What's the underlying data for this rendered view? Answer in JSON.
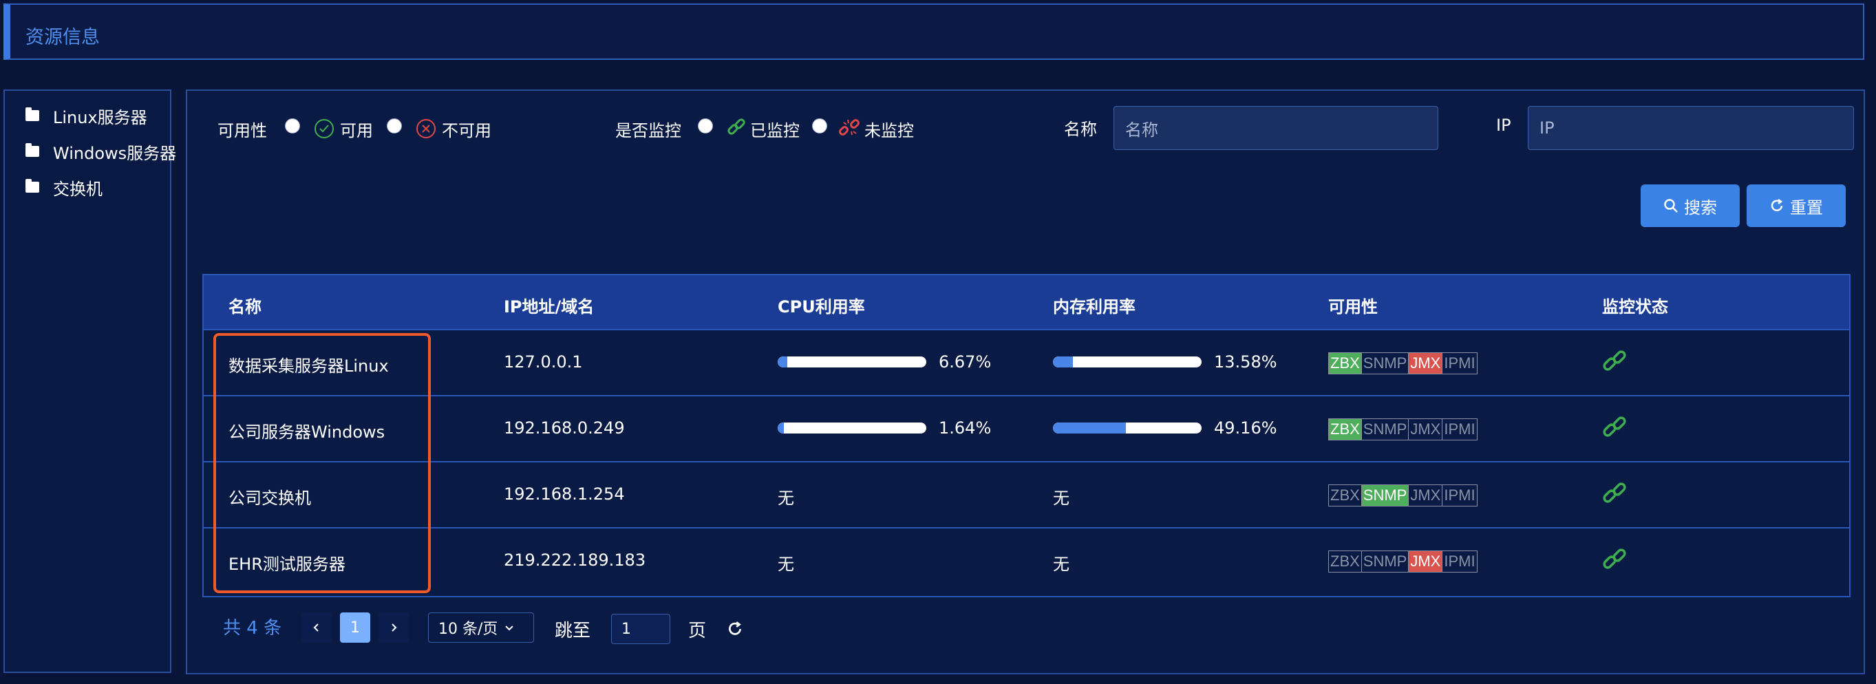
{
  "header": {
    "title": "资源信息"
  },
  "sidebar": {
    "items": [
      {
        "label": "Linux服务器",
        "icon": "folder-icon"
      },
      {
        "label": "Windows服务器",
        "icon": "folder-icon"
      },
      {
        "label": "交换机",
        "icon": "folder-icon"
      }
    ]
  },
  "filters": {
    "availability_label": "可用性",
    "available_label": "可用",
    "unavailable_label": "不可用",
    "monitor_label": "是否监控",
    "monitored_label": "已监控",
    "unmonitored_label": "未监控",
    "name_label": "名称",
    "name_placeholder": "名称",
    "ip_label": "IP",
    "ip_placeholder": "IP"
  },
  "buttons": {
    "search": "搜索",
    "reset": "重置"
  },
  "table": {
    "headers": [
      "名称",
      "IP地址/域名",
      "CPU利用率",
      "内存利用率",
      "可用性",
      "监控状态"
    ],
    "rows": [
      {
        "name": "数据采集服务器Linux",
        "ip": "127.0.0.1",
        "cpu": "6.67%",
        "cpu_value": 0.0667,
        "mem": "13.58%",
        "mem_value": 0.1358,
        "protocols": {
          "ZBX": "green",
          "SNMP": "off",
          "JMX": "red",
          "IPMI": "off"
        },
        "monitor": "monitored"
      },
      {
        "name": "公司服务器Windows",
        "ip": "192.168.0.249",
        "cpu": "1.64%",
        "cpu_value": 0.0164,
        "mem": "49.16%",
        "mem_value": 0.4916,
        "protocols": {
          "ZBX": "green",
          "SNMP": "off",
          "JMX": "off",
          "IPMI": "off"
        },
        "monitor": "monitored"
      },
      {
        "name": "公司交换机",
        "ip": "192.168.1.254",
        "cpu": "无",
        "cpu_value": null,
        "mem": "无",
        "mem_value": null,
        "protocols": {
          "ZBX": "off",
          "SNMP": "green",
          "JMX": "off",
          "IPMI": "off"
        },
        "monitor": "monitored"
      },
      {
        "name": "EHR测试服务器",
        "ip": "219.222.189.183",
        "cpu": "无",
        "cpu_value": null,
        "mem": "无",
        "mem_value": null,
        "protocols": {
          "ZBX": "off",
          "SNMP": "off",
          "JMX": "red",
          "IPMI": "off"
        },
        "monitor": "monitored"
      }
    ]
  },
  "pagination": {
    "total_text": "共 4 条",
    "current_page": "1",
    "page_size": "10 条/页",
    "jump_label": "跳至",
    "jump_value": "1",
    "page_suffix": "页"
  },
  "colors": {
    "accent": "#3b82e6",
    "header_bg": "#1b3c94",
    "highlight": "#f05a2a",
    "tag_green": "#4fae5b",
    "tag_red": "#d9534f"
  }
}
